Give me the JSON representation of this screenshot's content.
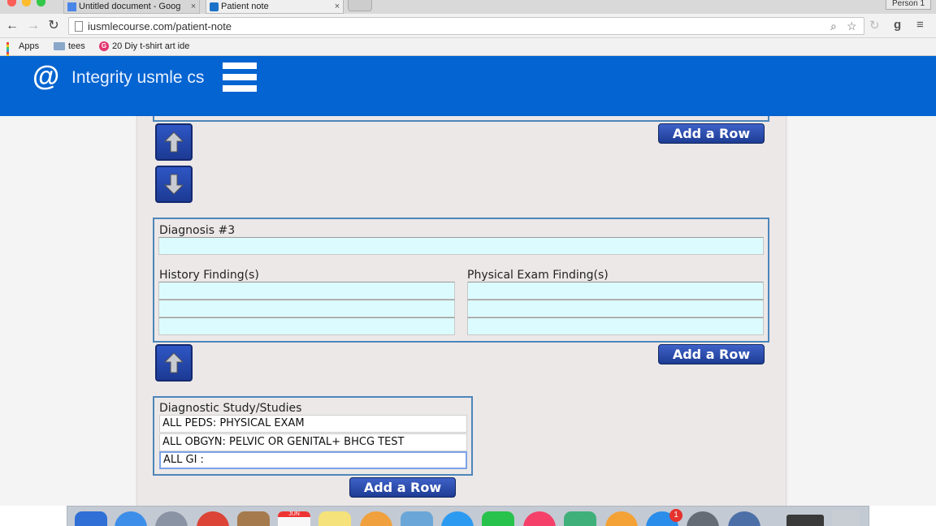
{
  "browser": {
    "tabs": [
      {
        "label": "Untitled document - Goog",
        "active": false,
        "close": "×"
      },
      {
        "label": "Patient note",
        "active": true,
        "close": "×"
      }
    ],
    "profile": "Person 1",
    "url": "iusmlecourse.com/patient-note",
    "bookmarks": [
      {
        "label": "Apps",
        "icon": "apps-grid-icon"
      },
      {
        "label": "tees",
        "icon": "folder-icon"
      },
      {
        "label": "20 Diy t-shirt art ide",
        "icon": "g-favicon-icon"
      }
    ]
  },
  "site": {
    "logo": "@",
    "brand": "Integrity usmle cs"
  },
  "note": {
    "add_row_label": "Add a Row",
    "diagnosis": {
      "title": "Diagnosis #3",
      "history_label": "History Finding(s)",
      "exam_label": "Physical Exam Finding(s)",
      "diagnosis_value": "",
      "history_values": [
        "",
        "",
        ""
      ],
      "exam_values": [
        "",
        "",
        ""
      ]
    },
    "studies": {
      "title": "Diagnostic Study/Studies",
      "rows": [
        "ALL PEDS: PHYSICAL EXAM",
        "ALL OBGYN: PELVIC OR GENITAL+ BHCG TEST",
        "ALL GI :"
      ]
    }
  },
  "dock": {
    "calendar_month": "JUN",
    "app_store_badge": "1"
  },
  "colors": {
    "header_blue": "#0464d1",
    "field_cyan": "#dcfbff",
    "button_blue": "#1e3c93",
    "box_border": "#4d86b8"
  }
}
